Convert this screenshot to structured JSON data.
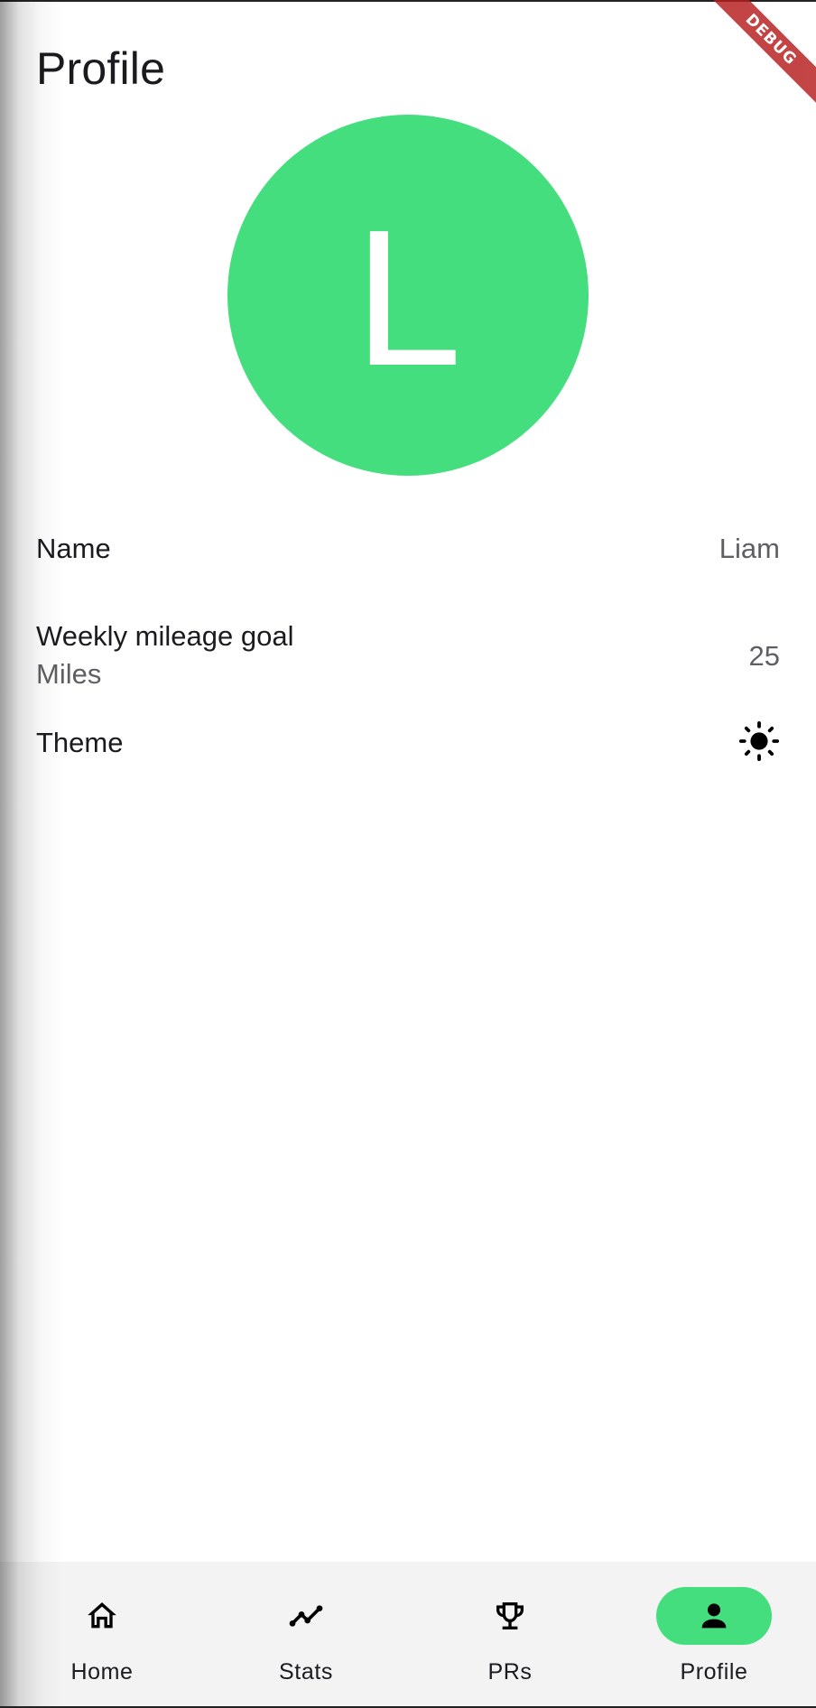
{
  "header": {
    "title": "Profile",
    "debug_banner": "DEBUG"
  },
  "avatar": {
    "initial": "L",
    "color": "#44de7e"
  },
  "settings": {
    "name": {
      "label": "Name",
      "value": "Liam"
    },
    "mileage_goal": {
      "label": "Weekly mileage goal",
      "sublabel": "Miles",
      "value": "25"
    },
    "theme": {
      "label": "Theme",
      "icon": "sun-icon"
    }
  },
  "bottom_nav": {
    "active": "Profile",
    "accent": "#44de7e",
    "items": [
      {
        "label": "Home",
        "icon": "home-icon"
      },
      {
        "label": "Stats",
        "icon": "stats-icon"
      },
      {
        "label": "PRs",
        "icon": "trophy-icon"
      },
      {
        "label": "Profile",
        "icon": "person-icon"
      }
    ]
  }
}
